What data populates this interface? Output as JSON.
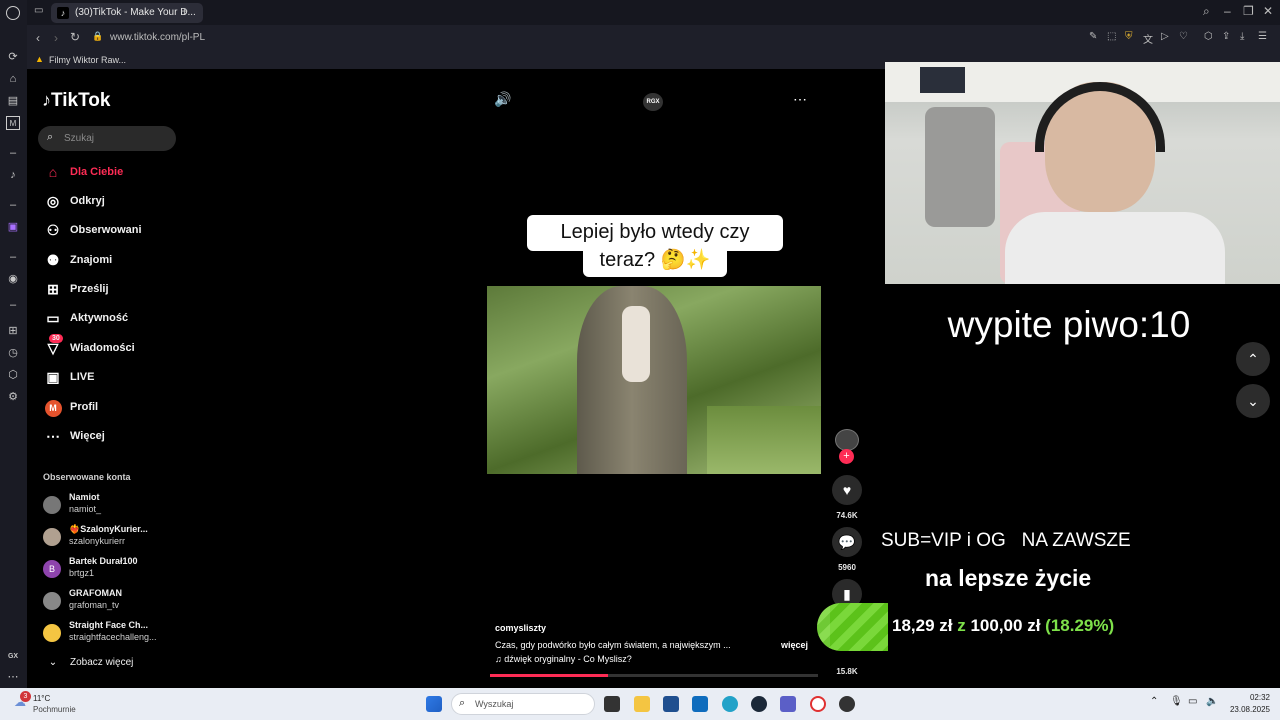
{
  "browser": {
    "tab_title": "(30)TikTok - Make Your D...",
    "url": "www.tiktok.com/pl-PL",
    "bookmark": "Filmy Wiktor Raw..."
  },
  "tiktok": {
    "logo": "TikTok",
    "search_placeholder": "Szukaj",
    "nav": [
      {
        "label": "Dla Ciebie",
        "icon": "home-icon"
      },
      {
        "label": "Odkryj",
        "icon": "compass-icon"
      },
      {
        "label": "Obserwowani",
        "icon": "following-icon"
      },
      {
        "label": "Znajomi",
        "icon": "friends-icon"
      },
      {
        "label": "Prześlij",
        "icon": "upload-icon"
      },
      {
        "label": "Aktywność",
        "icon": "activity-icon"
      },
      {
        "label": "Wiadomości",
        "icon": "messages-icon",
        "badge": "30"
      },
      {
        "label": "LIVE",
        "icon": "live-icon"
      },
      {
        "label": "Profil",
        "icon": "profile-avatar",
        "avatar_letter": "M"
      },
      {
        "label": "Więcej",
        "icon": "more-icon"
      }
    ],
    "followed_title": "Obserwowane konta",
    "followed": [
      {
        "name": "Namiot",
        "handle": "namiot_",
        "color": "#777777"
      },
      {
        "name": "❤️‍🔥SzalonyKurier...",
        "handle": "szalonykurierr",
        "color": "#b0a090"
      },
      {
        "name": "Bartek Durał100",
        "handle": "brtgz1",
        "color": "#8e44ad",
        "letter": "B"
      },
      {
        "name": "GRAFOMAN",
        "handle": "grafoman_tv",
        "color": "#888888"
      },
      {
        "name": "Straight Face Ch...",
        "handle": "straightfacechalleng...",
        "color": "#f4c542"
      }
    ],
    "see_more": "Zobacz więcej",
    "video": {
      "caption_line1": "Lepiej było wtedy czy",
      "caption_line2": "teraz? 🤔✨",
      "top_badge": "RGX",
      "author": "comysliszty",
      "description": "Czas, gdy podwórko było całym światem, a największym ...",
      "more": "więcej",
      "sound": "dźwięk oryginalny - Co Myslisz?",
      "likes": "74.6K",
      "comments": "5960",
      "shares": "15.8K",
      "progress": 0.36
    }
  },
  "overlay": {
    "beer": "wypite piwo:10",
    "sub_line": "SUB=VIP i OG   NA ZAWSZE",
    "goal_title": "na lepsze życie",
    "goal_current": "18,29 zł",
    "goal_sep": "z",
    "goal_total": "100,00 zł",
    "goal_percent": "(18.29%)",
    "goal_fraction": 0.1829
  },
  "taskbar": {
    "weather_temp": "11°C",
    "weather_desc": "Pochmurnie",
    "weather_badge": "3",
    "search": "Wyszukaj",
    "time": "02:32",
    "date": "23.08.2025"
  },
  "colors": {
    "tiktok_red": "#fe2c55",
    "goal_green": "#7ee04a",
    "goal_bar": "#5cc21a"
  }
}
